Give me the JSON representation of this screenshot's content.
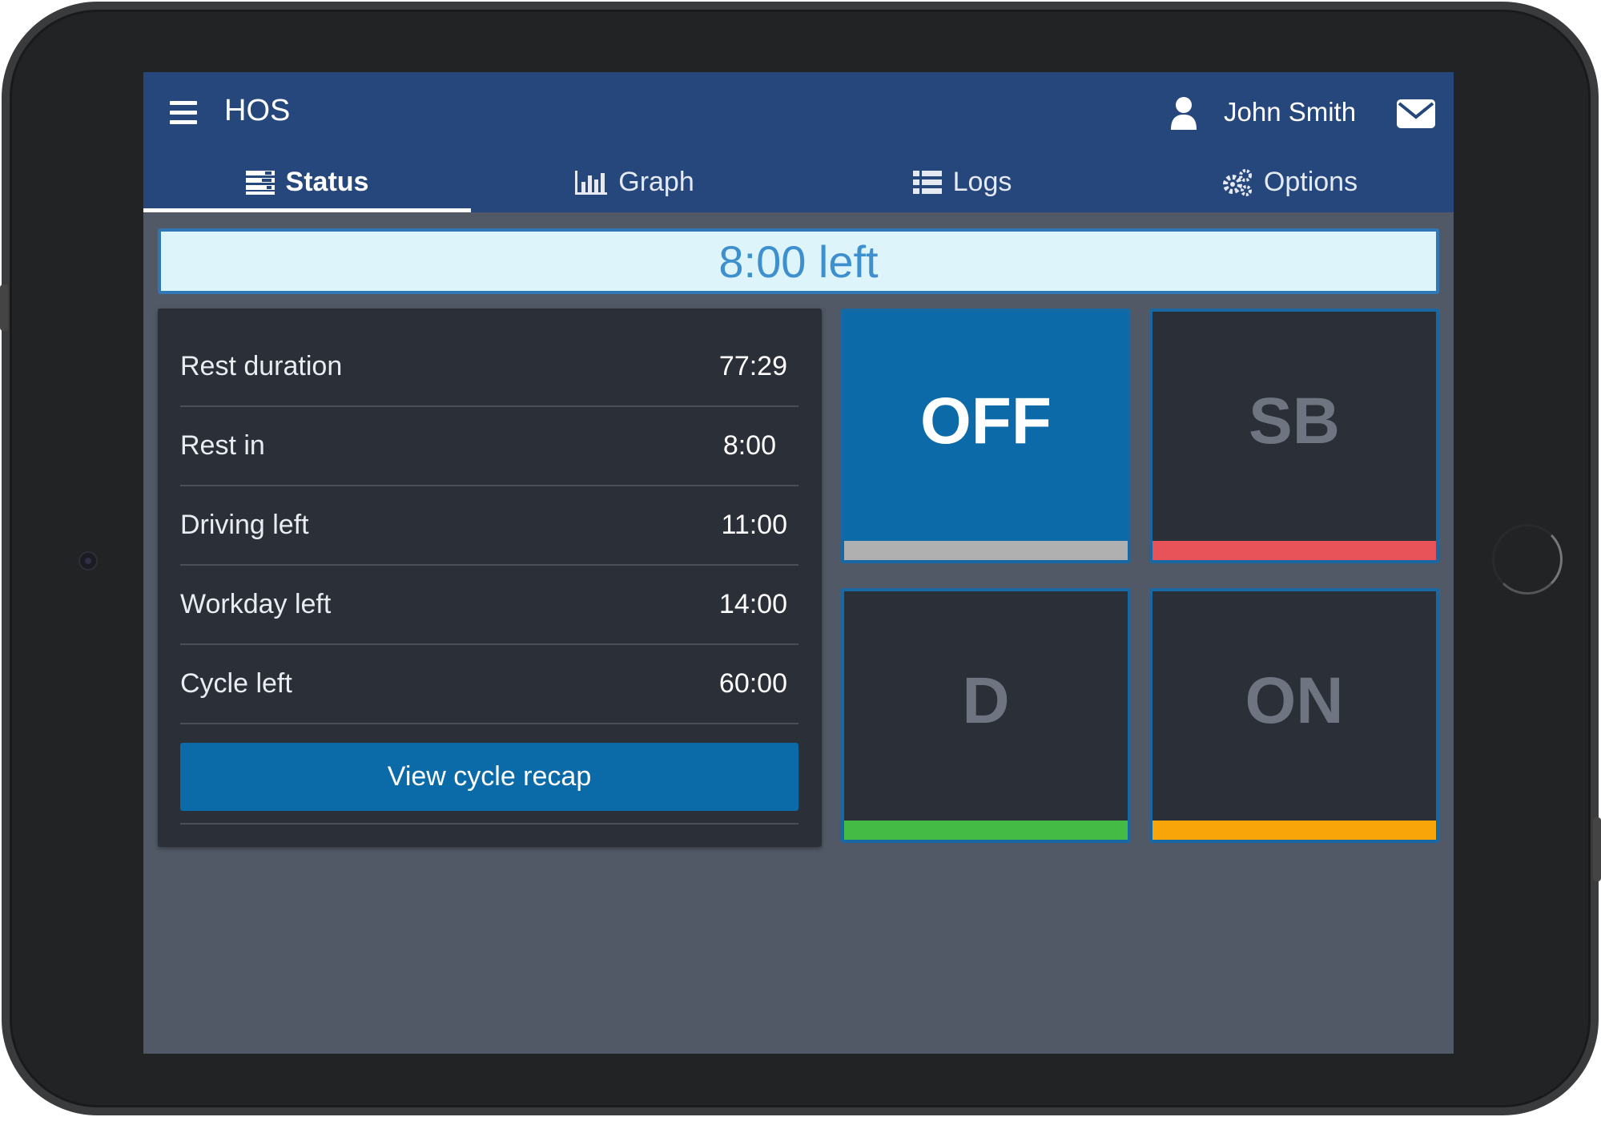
{
  "header": {
    "app_title": "HOS",
    "user_name": "John Smith",
    "menu_icon": "hamburger-menu-icon",
    "user_icon": "user-icon",
    "mail_icon": "envelope-icon"
  },
  "tabs": [
    {
      "label": "Status",
      "icon": "status-list-icon",
      "active": true
    },
    {
      "label": "Graph",
      "icon": "bar-chart-icon",
      "active": false
    },
    {
      "label": "Logs",
      "icon": "list-icon",
      "active": false
    },
    {
      "label": "Options",
      "icon": "gears-icon",
      "active": false
    }
  ],
  "time_left": "8:00 left",
  "status_rows": [
    {
      "label": "Rest duration",
      "value": "77:29"
    },
    {
      "label": "Rest in",
      "value": "8:00"
    },
    {
      "label": "Driving left",
      "value": "11:00"
    },
    {
      "label": "Workday left",
      "value": "14:00"
    },
    {
      "label": "Cycle left",
      "value": "60:00"
    }
  ],
  "recap_button": "View cycle recap",
  "duty_statuses": [
    {
      "label": "OFF",
      "active": true,
      "color": "#b0b0b0"
    },
    {
      "label": "SB",
      "active": false,
      "color": "#e8535a"
    },
    {
      "label": "D",
      "active": false,
      "color": "#44bb44"
    },
    {
      "label": "ON",
      "active": false,
      "color": "#f8a50a"
    }
  ],
  "colors": {
    "appbar": "#26477b",
    "screen_bg": "#515966",
    "panel_bg": "#2b2f38",
    "accent_blue": "#0d6aa8",
    "banner_bg": "#ddf4fb",
    "banner_text": "#3d8fce"
  }
}
